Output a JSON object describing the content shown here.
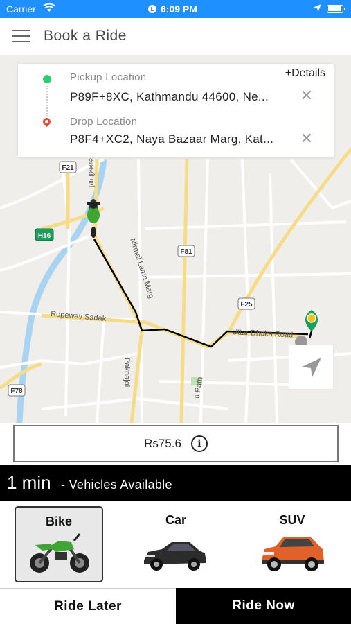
{
  "status_bar": {
    "carrier": "Carrier",
    "time": "6:09 PM"
  },
  "navbar": {
    "title": "Book a Ride",
    "menu_icon": "hamburger-menu-icon"
  },
  "location_card": {
    "details_link": "+Details",
    "pickup": {
      "label": "Pickup Location",
      "value": "P89F+8XC, Kathmandu 44600, Ne..."
    },
    "drop": {
      "label": "Drop Location",
      "value": "P8F4+XC2, Naya Bazaar Marg, Kat..."
    }
  },
  "map": {
    "road_labels": {
      "f21": "F21",
      "h16": "H16",
      "f81": "F81",
      "f25": "F25",
      "f78": "F78",
      "ropeway": "Ropeway Sadak",
      "nirmal": "Nirmal Lama Marg",
      "uttar": "Uttar Dhoka Road",
      "paknajol": "Paknajol",
      "path": "ti Path",
      "vertical_top": "ट्याकसी मार्ग"
    },
    "route_color": "#000000",
    "pin_color": "#1a9e5b"
  },
  "fare": {
    "text": "Rs75.6"
  },
  "availability": {
    "eta": "1 min",
    "text": "- Vehicles Available"
  },
  "vehicles": [
    {
      "name": "Bike",
      "selected": true
    },
    {
      "name": "Car",
      "selected": false
    },
    {
      "name": "SUV",
      "selected": false
    }
  ],
  "actions": {
    "ride_later": "Ride Later",
    "ride_now": "Ride Now"
  }
}
